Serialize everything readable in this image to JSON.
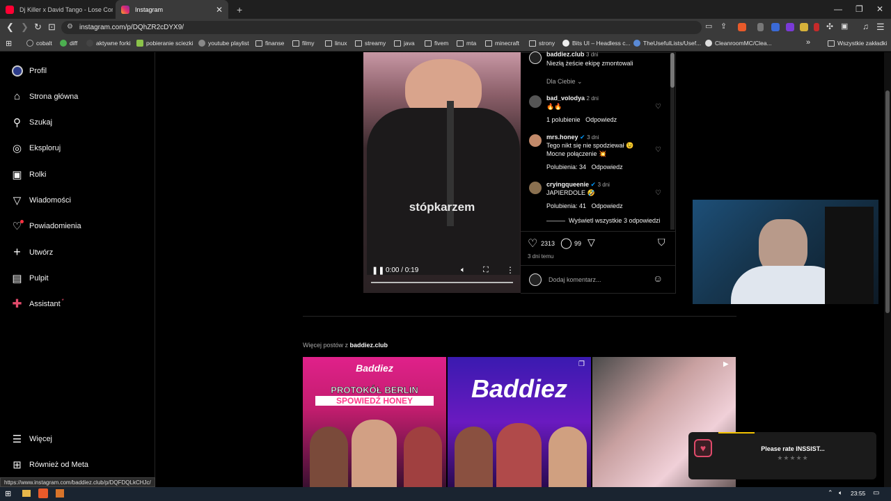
{
  "tabs": [
    {
      "title": "Dj Killer x David Tango - Lose Contro",
      "active": false
    },
    {
      "title": "Instagram",
      "active": true
    }
  ],
  "new_tab": "+",
  "address": {
    "url": "instagram.com/p/DQhZR2cDYX9/"
  },
  "bookmarks": [
    "cobalt",
    "diff",
    "aktywne forki",
    "pobieranie sciezki",
    "youtube playlist",
    "finanse",
    "filmy",
    "linux",
    "streamy",
    "java",
    "fivem",
    "mta",
    "minecraft",
    "strony",
    "Bits UI – Headless c...",
    "TheUsefulLists/Usef...",
    "CleanroomMC/Clea..."
  ],
  "bookmarks_more": "»",
  "all_bookmarks": "Wszystkie zakładki",
  "sidebar": {
    "items": [
      "Profil",
      "Strona główna",
      "Szukaj",
      "Eksploruj",
      "Rolki",
      "Wiadomości",
      "Powiadomienia",
      "Utwórz",
      "Pulpit",
      "Assistant"
    ],
    "bottom": [
      "Więcej",
      "Również od Meta"
    ]
  },
  "video": {
    "caption": "stópkarzem",
    "time": "0:00 / 0:19",
    "progress": 0
  },
  "post": {
    "author": "baddiez.club",
    "author_age": "3 dni",
    "author_text": "Niezłą żeście ekipę zmontowali",
    "filter": "Dla Ciebie",
    "comments": [
      {
        "user": "bad_volodya",
        "age": "2 dni",
        "text": "🔥🔥",
        "meta": "1 polubienie",
        "reply": "Odpowiedz"
      },
      {
        "user": "mrs.honey",
        "age": "3 dni",
        "text": "Tego nikt się nie spodziewał 😉",
        "text2": "Mocne połączenie 💥",
        "meta": "Polubienia: 34",
        "reply": "Odpowiedz"
      },
      {
        "user": "cryingqueenie",
        "age": "3 dni",
        "text": "JAPIERDOLE 🤣",
        "meta": "Polubienia: 41",
        "reply": "Odpowiedz"
      }
    ],
    "view_replies": "Wyświetl wszystkie 3 odpowiedzi",
    "likes": "2313",
    "comment_count": "99",
    "posted": "3 dni temu",
    "add_comment_placeholder": "Dodaj komentarz..."
  },
  "more_posts": {
    "prefix": "Więcej postów z ",
    "account": "baddiez.club"
  },
  "thumbs": [
    {
      "title1": "PROTOKÓŁ BERLIN",
      "title2": "SPOWIEDŹ HONEY",
      "logo": "Baddiez"
    },
    {
      "logo": "Baddiez"
    },
    {}
  ],
  "toast": {
    "text": "Please rate INSSIST...",
    "stars": "★★★★★"
  },
  "status_url": "https://www.instagram.com/baddiez.club/p/DQFDQLkCHJc/",
  "clock": "23:55",
  "colors": {
    "accent": "#0095f6",
    "notif": "#ff3040",
    "assistant": "#e04a6a"
  }
}
